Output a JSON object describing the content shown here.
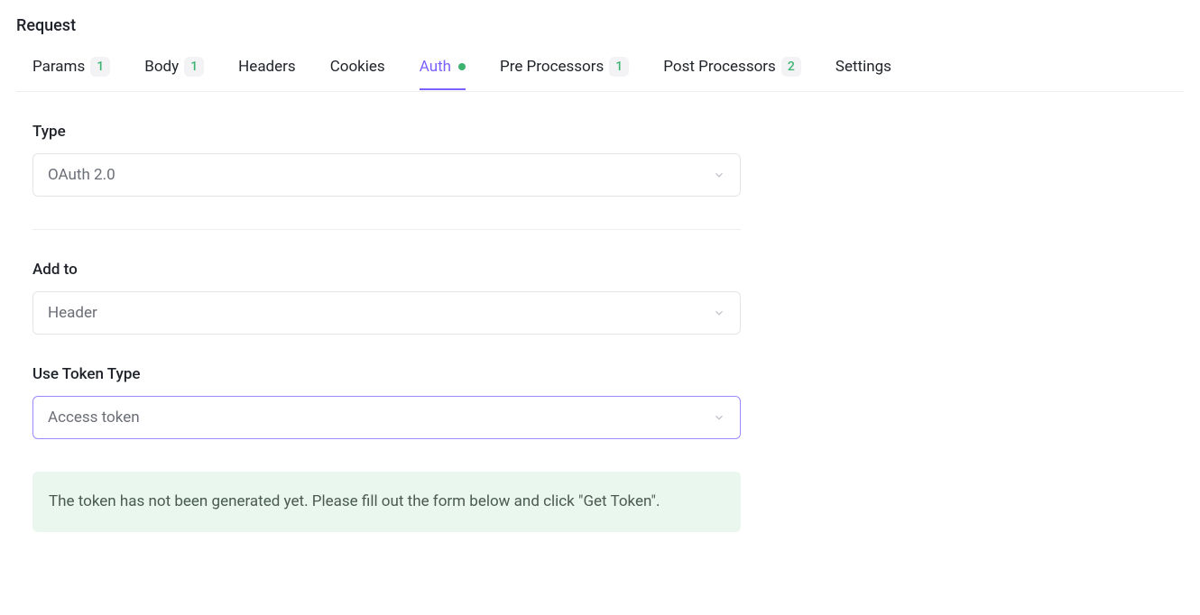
{
  "sectionTitle": "Request",
  "tabs": {
    "params": {
      "label": "Params",
      "badge": "1"
    },
    "body": {
      "label": "Body",
      "badge": "1"
    },
    "headers": {
      "label": "Headers"
    },
    "cookies": {
      "label": "Cookies"
    },
    "auth": {
      "label": "Auth"
    },
    "preProcessors": {
      "label": "Pre Processors",
      "badge": "1"
    },
    "postProcessors": {
      "label": "Post Processors",
      "badge": "2"
    },
    "settings": {
      "label": "Settings"
    }
  },
  "auth": {
    "typeLabel": "Type",
    "typeValue": "OAuth 2.0",
    "addToLabel": "Add to",
    "addToValue": "Header",
    "useTokenTypeLabel": "Use Token Type",
    "useTokenTypeValue": "Access token",
    "alert": "The token has not been generated yet. Please fill out the form below and click \"Get Token\"."
  }
}
